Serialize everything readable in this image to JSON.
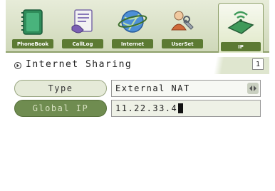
{
  "tabs": [
    {
      "label": "PhoneBook",
      "icon": "phonebook-icon"
    },
    {
      "label": "CallLog",
      "icon": "call-log-icon"
    },
    {
      "label": "Internet",
      "icon": "internet-globe-icon"
    },
    {
      "label": "UserSet",
      "icon": "user-settings-icon"
    },
    {
      "label": "IP",
      "icon": "ip-network-icon",
      "active": true
    }
  ],
  "header": {
    "title": "Internet Sharing",
    "page_indicator": "1"
  },
  "form": {
    "type_label": "Type",
    "type_value": "External NAT",
    "ip_label": "Global IP",
    "ip_value": "11.22.33.4"
  },
  "colors": {
    "accent": "#6f8c50",
    "tab_label_bg": "#5c7a33",
    "tabbar_bg": "#d7dfc3"
  }
}
